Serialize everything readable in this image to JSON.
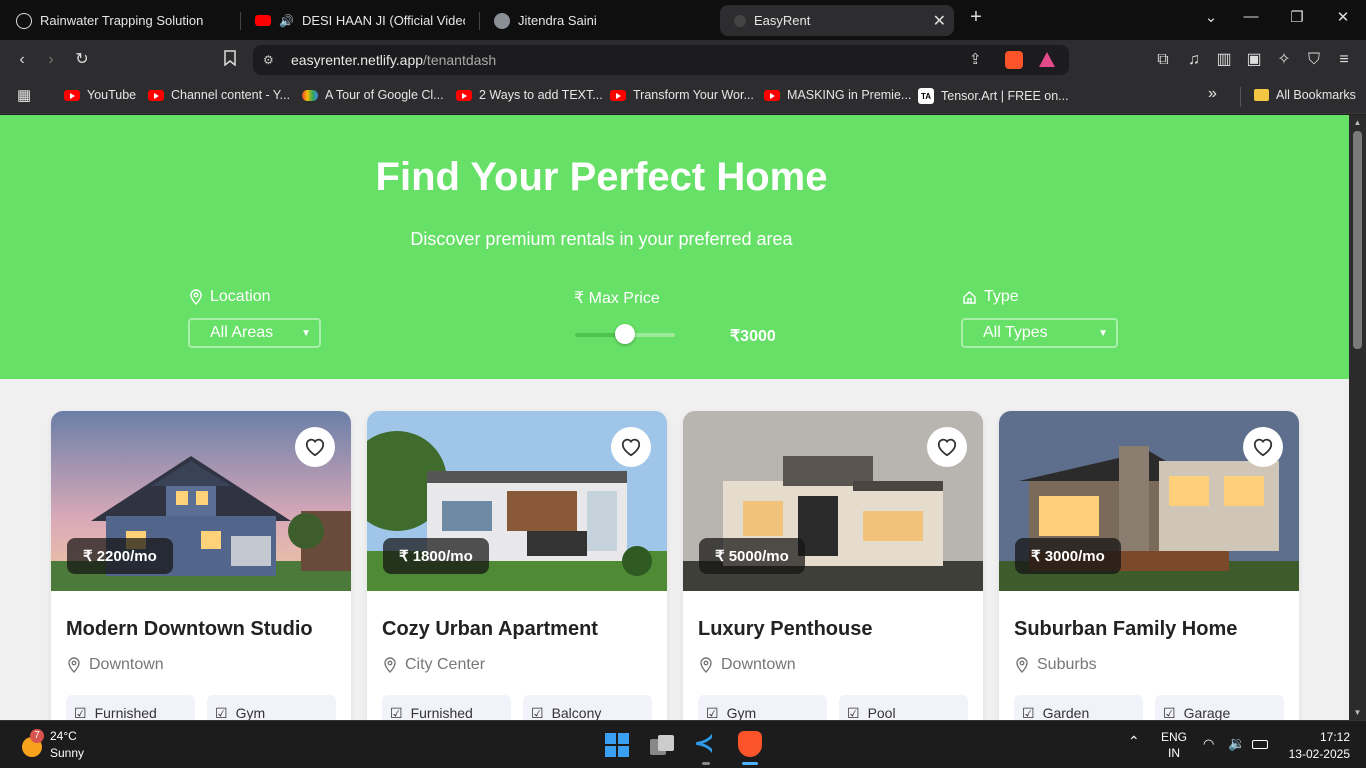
{
  "browser": {
    "tabs": [
      {
        "title": "Rainwater Trapping Solution",
        "icon": "chatgpt-icon"
      },
      {
        "title": "DESI HAAN JI (Official Video) No",
        "icon": "youtube-icon",
        "audio": true
      },
      {
        "title": "Jitendra Saini",
        "icon": "avatar-icon"
      },
      {
        "title": "EasyRent",
        "icon": "site-icon",
        "active": true
      }
    ],
    "url_main": "easyrenter.netlify.app",
    "url_path": "/tenantdash",
    "bookmarks": [
      {
        "label": "YouTube",
        "icon": "youtube-icon"
      },
      {
        "label": "Channel content - Y...",
        "icon": "youtube-icon"
      },
      {
        "label": "A Tour of Google Cl...",
        "icon": "google-cloud-icon"
      },
      {
        "label": "2 Ways to add TEXT...",
        "icon": "youtube-icon"
      },
      {
        "label": "Transform Your Wor...",
        "icon": "youtube-icon"
      },
      {
        "label": "MASKING in Premie...",
        "icon": "youtube-icon"
      },
      {
        "label": "Tensor.Art | FREE on...",
        "icon": "tensorart-icon"
      }
    ],
    "all_bookmarks": "All Bookmarks"
  },
  "hero": {
    "title": "Find Your Perfect Home",
    "subtitle": "Discover premium rentals in your preferred area",
    "location_label": "Location",
    "location_value": "All Areas",
    "price_label": "₹ Max Price",
    "price_value": "₹3000",
    "price_fraction": 0.5,
    "type_label": "Type",
    "type_value": "All Types"
  },
  "listings": [
    {
      "price": "₹ 2200/mo",
      "title": "Modern Downtown Studio",
      "location": "Downtown",
      "amenities": [
        "Furnished",
        "Gym"
      ]
    },
    {
      "price": "₹ 1800/mo",
      "title": "Cozy Urban Apartment",
      "location": "City Center",
      "amenities": [
        "Furnished",
        "Balcony"
      ]
    },
    {
      "price": "₹ 5000/mo",
      "title": "Luxury Penthouse",
      "location": "Downtown",
      "amenities": [
        "Gym",
        "Pool"
      ]
    },
    {
      "price": "₹ 3000/mo",
      "title": "Suburban Family Home",
      "location": "Suburbs",
      "amenities": [
        "Garden",
        "Garage"
      ]
    }
  ],
  "taskbar": {
    "weather_temp": "24°C",
    "weather_desc": "Sunny",
    "weather_badge": "7",
    "lang_1": "ENG",
    "lang_2": "IN",
    "time": "17:12",
    "date": "13-02-2025"
  },
  "colors": {
    "hero": "#66e066",
    "page": "#f0f0f0"
  }
}
